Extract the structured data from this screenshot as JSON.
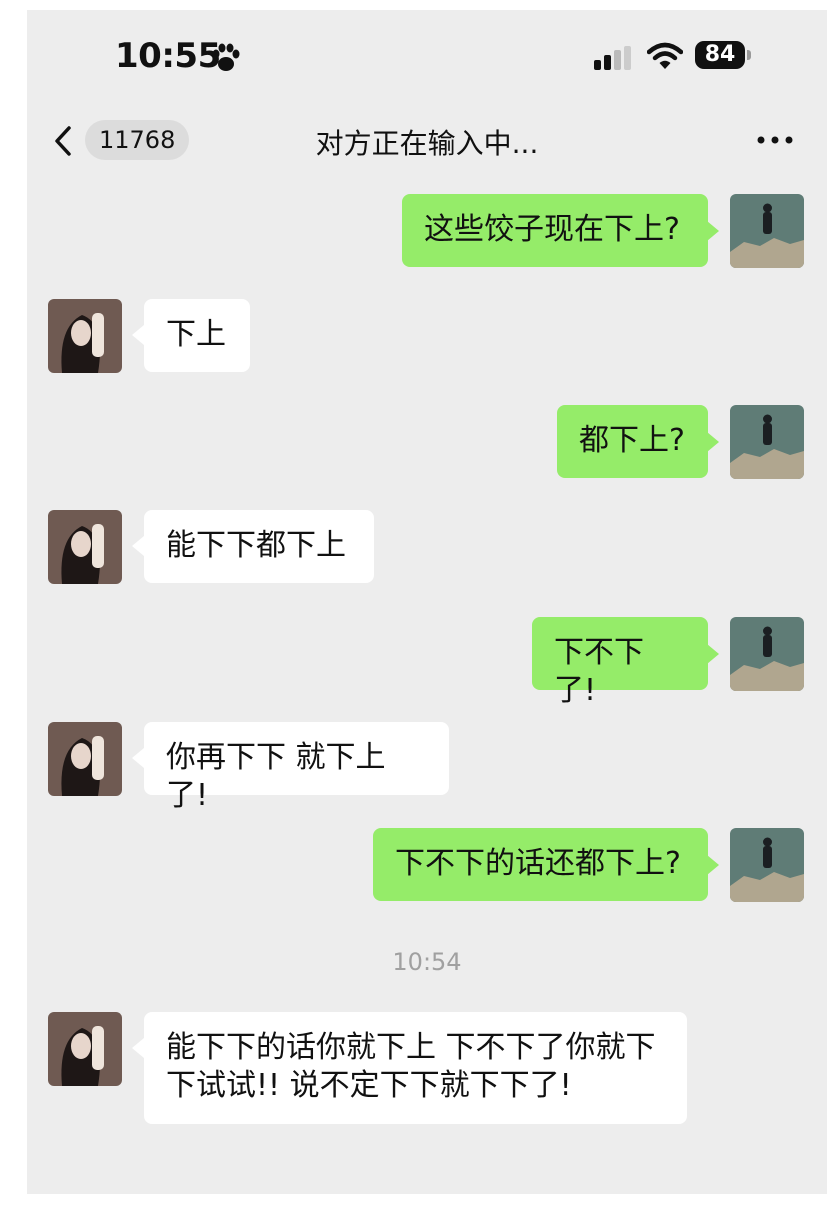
{
  "status_bar": {
    "time": "10:55",
    "battery": "84",
    "icons": [
      "paw-icon",
      "signal-icon",
      "wifi-icon",
      "battery-icon"
    ]
  },
  "nav": {
    "unread_count": "11768",
    "title": "对方正在输入中...",
    "icons": [
      "back-chevron-icon",
      "more-icon"
    ]
  },
  "colors": {
    "self_bubble": "#95ec69",
    "other_bubble": "#ffffff",
    "background": "#ededed"
  },
  "messages": [
    {
      "from": "self",
      "text": "这些饺子现在下上?"
    },
    {
      "from": "other",
      "text": "下上"
    },
    {
      "from": "self",
      "text": "都下上?"
    },
    {
      "from": "other",
      "text": "能下下都下上"
    },
    {
      "from": "self",
      "text": "下不下了!"
    },
    {
      "from": "other",
      "text": "你再下下 就下上了!"
    },
    {
      "from": "self",
      "text": "下不下的话还都下上?"
    },
    {
      "from": "other",
      "text": "能下下的话你就下上 下不下了你就下下试试!! 说不定下下就下下了!"
    }
  ],
  "timestamp": "10:54"
}
